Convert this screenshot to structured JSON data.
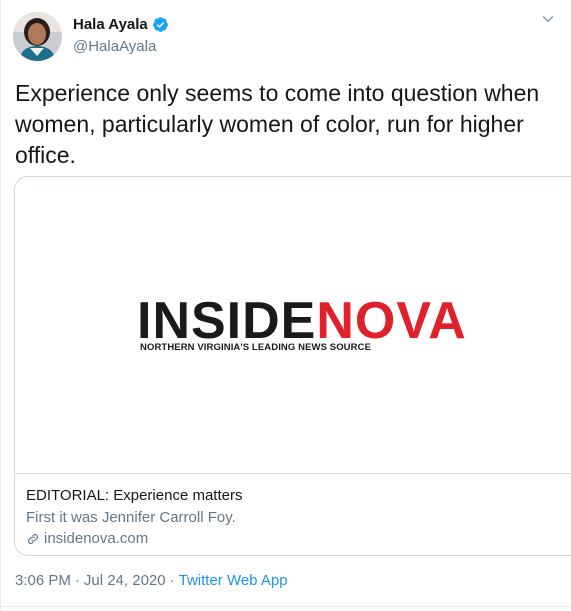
{
  "author": {
    "name": "Hala Ayala",
    "handle": "@HalaAyala",
    "verified": true
  },
  "tweet": {
    "text": "Experience only seems to come into question when women, particularly women of color, run for higher office."
  },
  "card": {
    "logo_part1": "INSIDE",
    "logo_part2": "NOVA",
    "logo_tagline": "NORTHERN VIRGINIA'S LEADING NEWS SOURCE",
    "title": "EDITORIAL: Experience matters",
    "description": "First it was Jennifer Carroll Foy.",
    "domain": "insidenova.com"
  },
  "meta": {
    "time": "3:06 PM",
    "separator": "·",
    "date": "Jul 24, 2020",
    "source": "Twitter Web App"
  },
  "colors": {
    "verified_blue": "#1da1f2",
    "link_blue": "#1b95e0",
    "secondary_text": "#657786",
    "logo_red": "#e0202a"
  },
  "icons": {
    "verified": "verified-badge-icon",
    "caret": "chevron-down-icon",
    "link": "link-icon"
  }
}
